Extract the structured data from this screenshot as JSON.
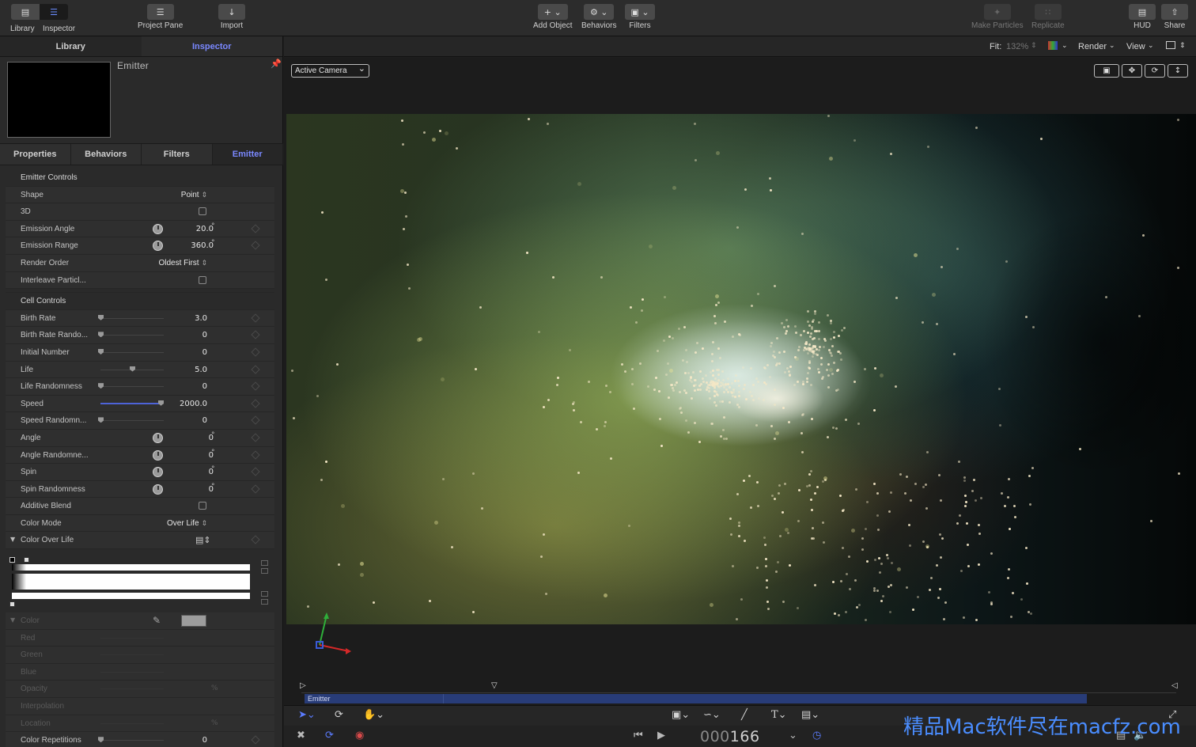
{
  "toolbar": {
    "library": "Library",
    "inspector": "Inspector",
    "project_pane": "Project Pane",
    "import": "Import",
    "add_object": "Add Object",
    "behaviors": "Behaviors",
    "filters": "Filters",
    "make_particles": "Make Particles",
    "replicate": "Replicate",
    "hud": "HUD",
    "share": "Share"
  },
  "panel_tabs": {
    "library": "Library",
    "inspector": "Inspector"
  },
  "object": {
    "name": "Emitter"
  },
  "inspector_tabs": [
    "Properties",
    "Behaviors",
    "Filters",
    "Emitter"
  ],
  "emitter_controls": {
    "header": "Emitter Controls",
    "shape_label": "Shape",
    "shape_value": "Point",
    "threed_label": "3D",
    "emission_angle_label": "Emission Angle",
    "emission_angle_value": "20.0",
    "emission_range_label": "Emission Range",
    "emission_range_value": "360.0",
    "render_order_label": "Render Order",
    "render_order_value": "Oldest First",
    "interleave_label": "Interleave Particl..."
  },
  "cell_controls": {
    "header": "Cell Controls",
    "birth_rate_label": "Birth Rate",
    "birth_rate_value": "3.0",
    "birth_rate_rand_label": "Birth Rate Rando...",
    "birth_rate_rand_value": "0",
    "initial_number_label": "Initial Number",
    "initial_number_value": "0",
    "life_label": "Life",
    "life_value": "5.0",
    "life_rand_label": "Life Randomness",
    "life_rand_value": "0",
    "speed_label": "Speed",
    "speed_value": "2000.0",
    "speed_rand_label": "Speed Randomn...",
    "speed_rand_value": "0",
    "angle_label": "Angle",
    "angle_value": "0",
    "angle_rand_label": "Angle Randomne...",
    "angle_rand_value": "0",
    "spin_label": "Spin",
    "spin_value": "0",
    "spin_rand_label": "Spin Randomness",
    "spin_rand_value": "0",
    "additive_label": "Additive Blend",
    "color_mode_label": "Color Mode",
    "color_mode_value": "Over Life",
    "color_over_life_label": "Color Over Life",
    "color_label": "Color",
    "red_label": "Red",
    "green_label": "Green",
    "blue_label": "Blue",
    "opacity_label": "Opacity",
    "interpolation_label": "Interpolation",
    "location_label": "Location",
    "color_rep_label": "Color Repetitions",
    "color_rep_value": "0"
  },
  "units": {
    "degree": "°",
    "percent": "%"
  },
  "canvas_bar": {
    "fit_label": "Fit:",
    "fit_value": "132%",
    "render": "Render",
    "view": "View"
  },
  "viewer": {
    "camera": "Active Camera"
  },
  "timeline": {
    "clip_name": "Emitter"
  },
  "transport": {
    "timecode_dim": "000",
    "timecode_value": "166"
  },
  "watermark": "精品Mac软件尽在macfz.com",
  "colors": {
    "accent": "#7a88ff",
    "timeline_clip": "#283c78",
    "slider_fill": "#4d63d8"
  }
}
